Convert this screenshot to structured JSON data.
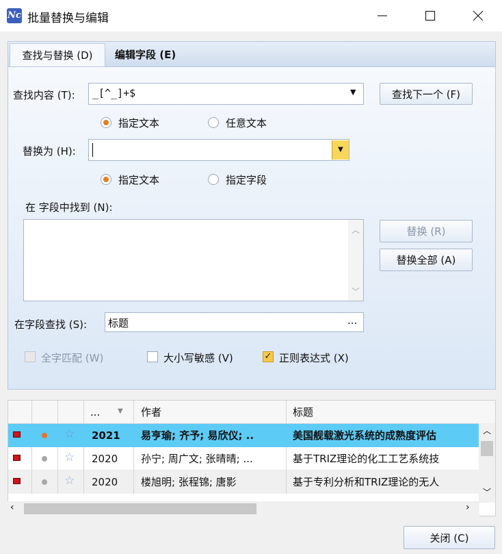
{
  "window": {
    "title": "批量替换与编辑",
    "icon_text": "Nc"
  },
  "tabs": [
    {
      "label": "查找与替换 (D)"
    },
    {
      "label": "编辑字段 (E)"
    }
  ],
  "find": {
    "label": "查找内容 (T):",
    "value": "_[^_]+$",
    "options": [
      "指定文本",
      "任意文本"
    ],
    "selected": "指定文本",
    "find_next_button": "查找下一个 (F)"
  },
  "replace": {
    "label": "替换为 (H):",
    "value": "",
    "options": [
      "指定文本",
      "指定字段"
    ],
    "selected": "指定文本"
  },
  "found_in_field": {
    "label": "在  字段中找到 (N):"
  },
  "buttons": {
    "replace": "替换 (R)",
    "replace_all": "替换全部 (A)",
    "close": "关闭 (C)"
  },
  "search_field": {
    "label": "在字段查找 (S):",
    "value": "标题",
    "more": "..."
  },
  "checks": [
    {
      "label": "全字匹配 (W)",
      "checked": false,
      "enabled": false
    },
    {
      "label": "大小写敏感 (V)",
      "checked": false,
      "enabled": true
    },
    {
      "label": "正则表达式 (X)",
      "checked": true,
      "enabled": true
    }
  ],
  "table": {
    "headers": {
      "year": "...",
      "author": "作者",
      "title": "标题"
    },
    "rows": [
      {
        "year": "2021",
        "author": "易亨瑜; 齐予; 易欣仪; ..",
        "title": "美国舰载激光系统的成熟度评估",
        "selected": true,
        "dot_color": "#e8722a"
      },
      {
        "year": "2020",
        "author": "孙宁; 周广文; 张晴晴; ...",
        "title": "基于TRIZ理论的化工工艺系统技",
        "selected": false,
        "dot_color": "#a8a8a8"
      },
      {
        "year": "2020",
        "author": "楼旭明; 张程锦; 唐影",
        "title": "基于专利分析和TRIZ理论的无人",
        "selected": false,
        "dot_color": "#a8a8a8"
      }
    ]
  },
  "colors": {
    "selected_row": "#5ccbf5",
    "accent": "#e67e22",
    "panel_border": "#b9c9e0"
  }
}
